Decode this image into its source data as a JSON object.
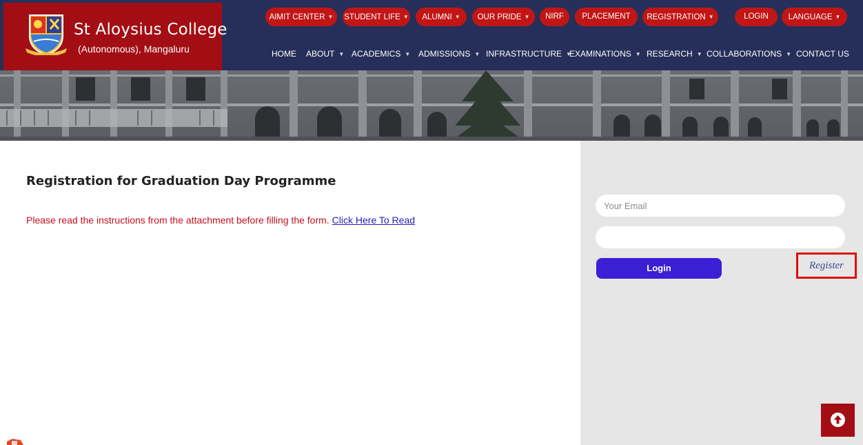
{
  "brand": {
    "name": "St Aloysius College",
    "subtitle": "(Autonomous), Mangaluru",
    "logo_icon": "college-crest-icon"
  },
  "top_nav": [
    {
      "label": "AIMIT CENTER",
      "has_dropdown": true
    },
    {
      "label": "STUDENT LIFE",
      "has_dropdown": true
    },
    {
      "label": "ALUMNI",
      "has_dropdown": true
    },
    {
      "label": "OUR PRIDE",
      "has_dropdown": true
    },
    {
      "label": "NIRF",
      "has_dropdown": false
    },
    {
      "label": "PLACEMENT",
      "has_dropdown": false
    },
    {
      "label": "REGISTRATION",
      "has_dropdown": true
    },
    {
      "label": "LOGIN",
      "has_dropdown": false
    },
    {
      "label": "LANGUAGE",
      "has_dropdown": true
    }
  ],
  "main_nav": [
    {
      "label": "HOME",
      "has_dropdown": false
    },
    {
      "label": "ABOUT",
      "has_dropdown": true
    },
    {
      "label": "ACADEMICS",
      "has_dropdown": true
    },
    {
      "label": "ADMISSIONS",
      "has_dropdown": true
    },
    {
      "label": "INFRASTRUCTURE",
      "has_dropdown": true
    },
    {
      "label": "EXAMINATIONS",
      "has_dropdown": true
    },
    {
      "label": "RESEARCH",
      "has_dropdown": true
    },
    {
      "label": "COLLABORATIONS",
      "has_dropdown": true
    },
    {
      "label": "CONTACT US",
      "has_dropdown": false
    }
  ],
  "content": {
    "title": "Registration for Graduation Day Programme",
    "instructions": "Please read the instructions from the attachment before filling the form.",
    "link_text": "Click Here To Read"
  },
  "login_form": {
    "email_placeholder": "Your Email",
    "email_value": "",
    "password_value": "",
    "login_label": "Login",
    "register_label": "Register"
  },
  "back_to_top_icon": "arrow-up-circle-icon",
  "colors": {
    "header_bg": "#262f59",
    "brand_red": "#a30e14",
    "pill_red": "#c11616",
    "instruction_red": "#c40f1e",
    "link_blue": "#2a1bb5",
    "button_blue": "#3b1fd4",
    "sidebar_bg": "#e6e6e6",
    "highlight_red": "#e00d0d"
  }
}
